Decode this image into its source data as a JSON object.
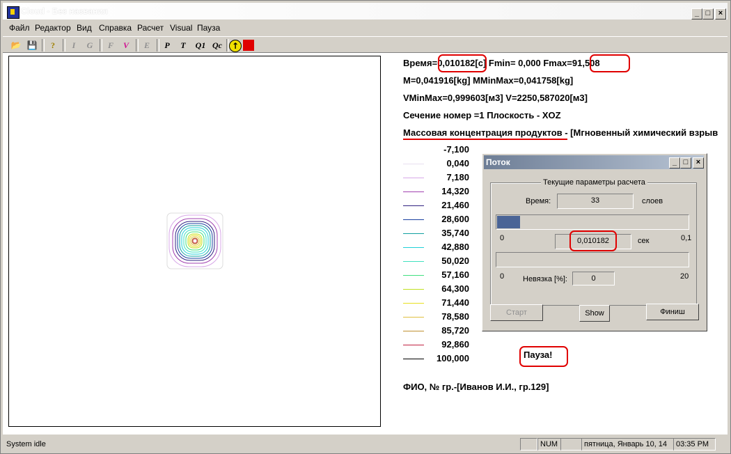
{
  "window": {
    "title": "Cloud - Без названия",
    "controls": [
      "_",
      "□",
      "×"
    ]
  },
  "menu": [
    "Файл",
    "Редактор",
    "Вид",
    "Справка",
    "Расчет",
    "Visual",
    "Пауза"
  ],
  "toolbar": {
    "buttons": [
      {
        "name": "open-icon",
        "glyph": "📂"
      },
      {
        "name": "save-icon",
        "glyph": "💾"
      },
      {
        "name": "help-icon",
        "glyph": "?"
      },
      {
        "name": "i-icon",
        "glyph": "I"
      },
      {
        "name": "g-icon",
        "glyph": "G"
      },
      {
        "name": "f-icon",
        "glyph": "F"
      },
      {
        "name": "v-icon",
        "glyph": "V"
      },
      {
        "name": "e-icon",
        "glyph": "E"
      },
      {
        "name": "p-icon",
        "glyph": "P"
      },
      {
        "name": "t-icon",
        "glyph": "T"
      },
      {
        "name": "q1-icon",
        "glyph": "Q1"
      },
      {
        "name": "qc-icon",
        "glyph": "Qc"
      },
      {
        "name": "run-icon",
        "glyph": "↑"
      },
      {
        "name": "stop-icon",
        "glyph": "■"
      }
    ]
  },
  "info": {
    "time_label": "Время=",
    "time_value": "0,010182",
    "fmin_text": "[c] Fmin=  0,000 Fmax=",
    "fmax_value": "91,508",
    "line2": "M=0,041916[kg] MMinMax=0,041758[kg]",
    "line3": "VMinMax=0,999603[м3] V=2250,587020[м3]",
    "line4": "Сечение номер =1   Плоскость - XOZ",
    "line5_a": "Массовая концентрация продуктов",
    "line5_b": " - [Мгновенный химический взрыв",
    "author": "ФИО, № гр.-[Иванов И.И., гр.129]",
    "pause": "Пауза!"
  },
  "legend": [
    {
      "value": "-7,100",
      "color": "#ffffff"
    },
    {
      "value": "0,040",
      "color": "#e8e0f0"
    },
    {
      "value": "7,180",
      "color": "#d8a8e8"
    },
    {
      "value": "14,320",
      "color": "#a040b0"
    },
    {
      "value": "21,460",
      "color": "#302080"
    },
    {
      "value": "28,600",
      "color": "#1840a0"
    },
    {
      "value": "35,740",
      "color": "#10a0a0"
    },
    {
      "value": "42,880",
      "color": "#20d0d8"
    },
    {
      "value": "50,020",
      "color": "#40e0c0"
    },
    {
      "value": "57,160",
      "color": "#40e080"
    },
    {
      "value": "64,300",
      "color": "#c0e020"
    },
    {
      "value": "71,440",
      "color": "#e8e020"
    },
    {
      "value": "78,580",
      "color": "#e0c040"
    },
    {
      "value": "85,720",
      "color": "#c09030"
    },
    {
      "value": "92,860",
      "color": "#c02040"
    },
    {
      "value": "100,000",
      "color": "#000000"
    }
  ],
  "dialog": {
    "title": "Поток",
    "group_label": "Текущие параметры расчета",
    "time_label": "Время:",
    "layers_value": "33",
    "layers_unit": "слоев",
    "progress": 0.12,
    "min1": "0",
    "max1": "0,1",
    "time_value": "0,010182",
    "time_unit": "сек",
    "min2": "0",
    "max2": "20",
    "residual_label": "Невязка [%]:",
    "residual_value": "0",
    "btn_start": "Старт",
    "btn_show": "Show",
    "btn_finish": "Финиш"
  },
  "status": {
    "text": "System idle",
    "num": "NUM",
    "date": "пятница, Январь 10, 14",
    "time": "03:35  PM"
  }
}
